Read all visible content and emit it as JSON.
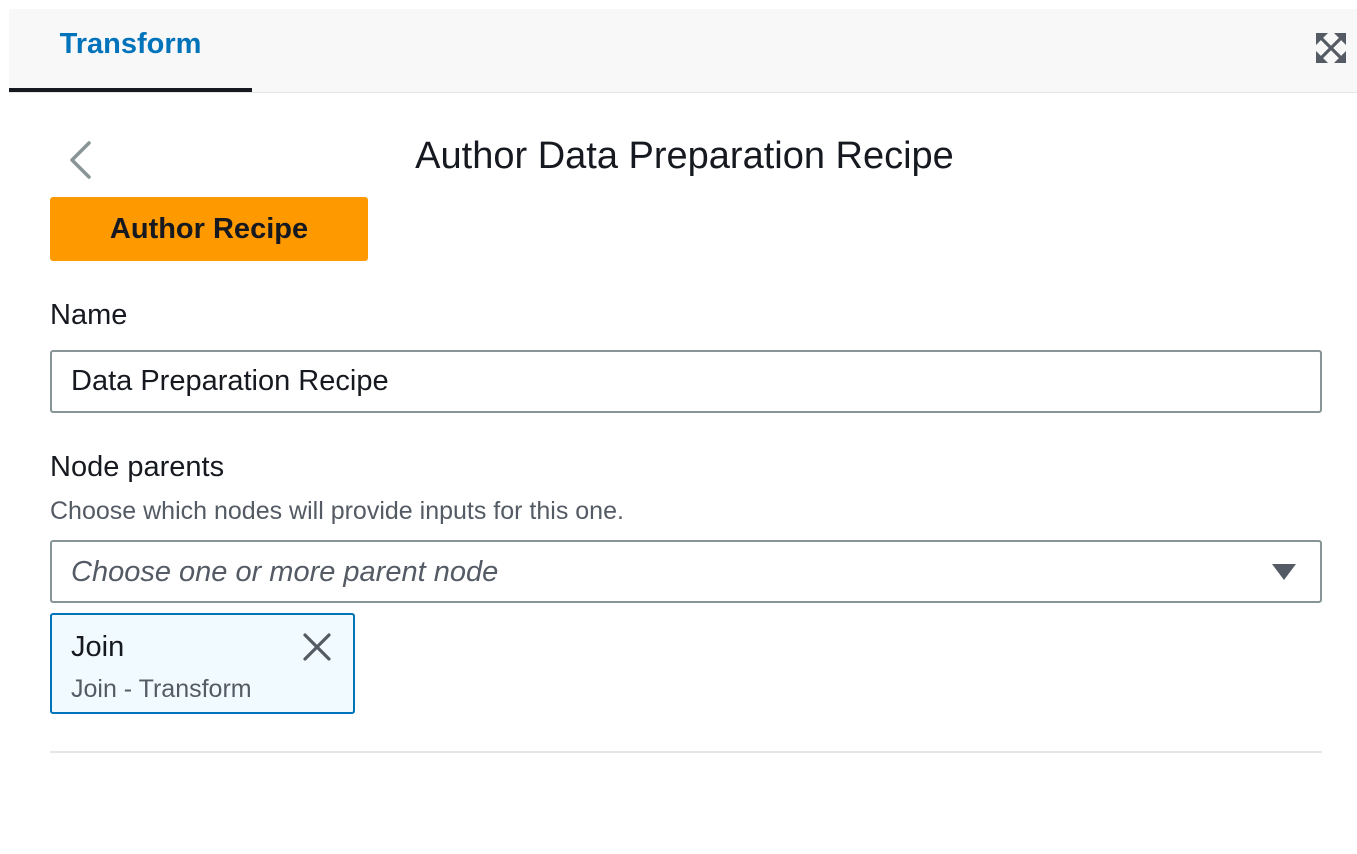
{
  "tabs": [
    {
      "label": "Transform",
      "active": true
    }
  ],
  "toolbar": {
    "expand_icon": "expand-arrows-icon"
  },
  "header": {
    "back_icon": "chevron-left-icon",
    "title": "Author Data Preparation Recipe"
  },
  "author_button": {
    "label": "Author Recipe"
  },
  "name_field": {
    "label": "Name",
    "value": "Data Preparation Recipe"
  },
  "node_parents": {
    "label": "Node parents",
    "description": "Choose which nodes will provide inputs for this one.",
    "placeholder": "Choose one or more parent node",
    "selected": [
      {
        "title": "Join",
        "subtitle": "Join - Transform"
      }
    ]
  },
  "colors": {
    "accent": "#0073bb",
    "primary_button": "#ff9900",
    "token_background": "#f1faff"
  }
}
